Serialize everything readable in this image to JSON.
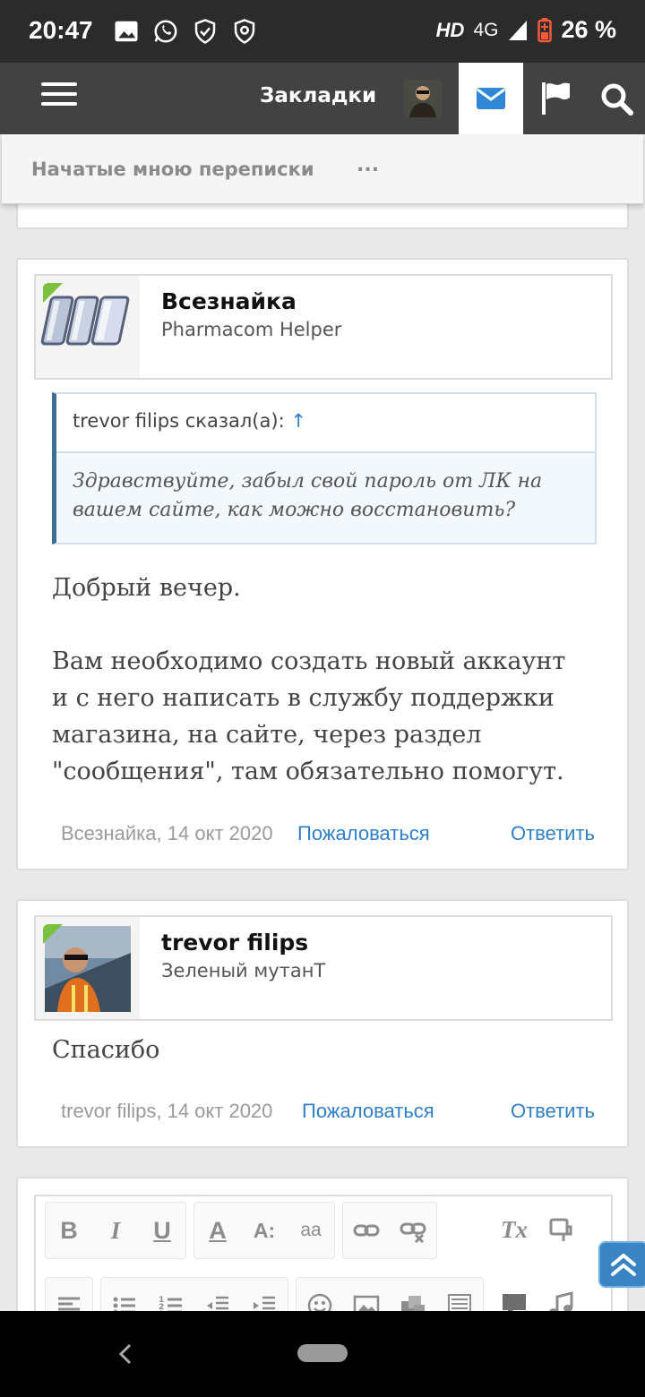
{
  "status_bar": {
    "time": "20:47",
    "left_icons": [
      "gallery-icon",
      "whatsapp-icon",
      "shield-check-icon",
      "shield-icon"
    ],
    "network_hd": "HD",
    "network_type": "4G",
    "battery": "26 %"
  },
  "navbar": {
    "title": "Закладки",
    "icons": [
      "menu-icon",
      "avatar",
      "mail-icon",
      "flag-icon",
      "search-icon"
    ]
  },
  "subheader": {
    "label": "Начатые мною переписки",
    "more": "..."
  },
  "posts": [
    {
      "username": "Всезнайка",
      "user_title": "Pharmacom Helper",
      "online": true,
      "quote": {
        "author": "trevor filips сказал(а):",
        "arrow": "↑",
        "text": "Здравствуйте, забыл свой пароль от ЛК на вашем сайте, как можно восстановить?"
      },
      "message_lines": [
        "Добрый вечер.",
        "",
        "Вам необходимо создать новый аккаунт",
        "и с него написать в службу поддержки",
        "магазина, на сайте, через раздел",
        "\"сообщения\", там обязательно помогут."
      ],
      "meta": "Всезнайка, 14 окт 2020",
      "report": "Пожаловаться",
      "reply": "Ответить"
    },
    {
      "username": "trevor filips",
      "user_title": "Зеленый мутанТ",
      "online": true,
      "message_lines": [
        "Спасибо"
      ],
      "meta": "trevor filips, 14 окт 2020",
      "report": "Пожаловаться",
      "reply": "Ответить"
    }
  ],
  "editor": {
    "row1": [
      "B",
      "I",
      "U",
      "A",
      "A:",
      "aa",
      "link",
      "unlink",
      "Tx",
      "paint"
    ],
    "row2": [
      "align",
      "bullets",
      "numbers",
      "outdent",
      "indent",
      "smile",
      "image",
      "media",
      "code",
      "comment",
      "music"
    ]
  },
  "colors": {
    "accent_blue": "#2f7fc9",
    "navbar": "#424242",
    "online_green": "#7cc242",
    "quote_border": "#3c6e97"
  }
}
